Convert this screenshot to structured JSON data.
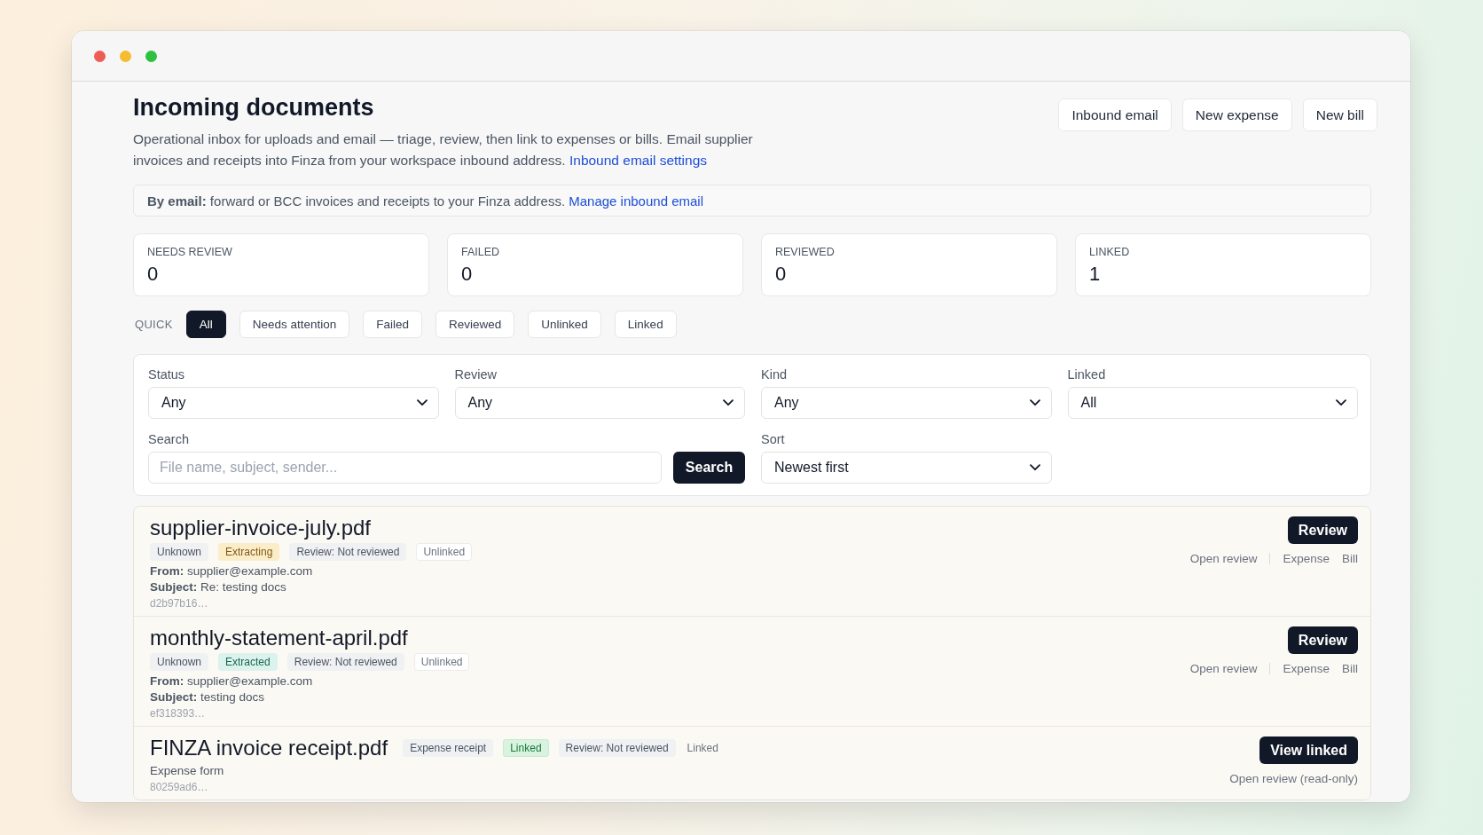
{
  "header": {
    "title": "Incoming documents",
    "description": "Operational inbox for uploads and email — triage, review, then link to expenses or bills. Email supplier invoices and receipts into Finza from your workspace inbound address.",
    "link": "Inbound email settings",
    "buttons": [
      "Inbound email",
      "New expense",
      "New bill"
    ]
  },
  "email_notice": {
    "text": "**By email:** forward or BCC invoices and receipts to your Finza address.",
    "link": "Manage inbound email"
  },
  "stats": [
    {
      "label": "NEEDS REVIEW",
      "value": "0"
    },
    {
      "label": "FAILED",
      "value": "0"
    },
    {
      "label": "REVIEWED",
      "value": "0"
    },
    {
      "label": "LINKED",
      "value": "1"
    }
  ],
  "quick_filters": {
    "label": "QUICK",
    "items": [
      {
        "label": "All",
        "selected": true
      },
      {
        "label": "Needs attention",
        "selected": false
      },
      {
        "label": "Failed",
        "selected": false
      },
      {
        "label": "Reviewed",
        "selected": false
      },
      {
        "label": "Unlinked",
        "selected": false
      },
      {
        "label": "Linked",
        "selected": false
      }
    ]
  },
  "filters": {
    "selects": [
      {
        "label": "Status",
        "value": "Any"
      },
      {
        "label": "Review",
        "value": "Any"
      },
      {
        "label": "Kind",
        "value": "Any"
      },
      {
        "label": "Linked",
        "value": "All"
      }
    ],
    "search": {
      "label": "Search",
      "placeholder": "File name, subject, sender...",
      "button": "Search"
    },
    "sort": {
      "label": "Sort",
      "value": "Newest first"
    }
  },
  "documents": [
    {
      "kind": "email",
      "name": "supplier-invoice-july.pdf",
      "badges": [
        {
          "label": "Unknown",
          "kind": "neutral"
        },
        {
          "label": "Extracting",
          "kind": "warning"
        },
        {
          "label": "Review: Not reviewed",
          "kind": "neutral"
        },
        {
          "label": "Unlinked",
          "kind": "outline"
        }
      ],
      "from": "**From:** supplier@example.com",
      "subject": "**Subject:** Re: testing docs",
      "id": "d2b97b16…",
      "action": "Review",
      "link_groups": [
        [
          "Open review"
        ],
        [
          "Expense",
          "Bill"
        ]
      ]
    },
    {
      "kind": "email",
      "name": "monthly-statement-april.pdf",
      "badges": [
        {
          "label": "Unknown",
          "kind": "neutral"
        },
        {
          "label": "Extracted",
          "kind": "info"
        },
        {
          "label": "Review: Not reviewed",
          "kind": "neutral"
        },
        {
          "label": "Unlinked",
          "kind": "outline"
        }
      ],
      "from": "**From:** supplier@example.com",
      "subject": "**Subject:** testing docs",
      "id": "ef318393…",
      "action": "Review",
      "link_groups": [
        [
          "Open review"
        ],
        [
          "Expense",
          "Bill"
        ]
      ]
    },
    {
      "kind": "form",
      "name": "FINZA invoice receipt.pdf",
      "badges": [
        {
          "label": "Expense receipt",
          "kind": "neutral"
        },
        {
          "label": "Linked",
          "kind": "success"
        },
        {
          "label": "Review: Not reviewed",
          "kind": "neutral"
        },
        {
          "label": "Linked",
          "kind": "plain"
        }
      ],
      "note": "Expense form",
      "id": "80259ad6…",
      "action": "View linked",
      "link_groups": [
        [
          "Open review (read-only)"
        ]
      ]
    }
  ]
}
